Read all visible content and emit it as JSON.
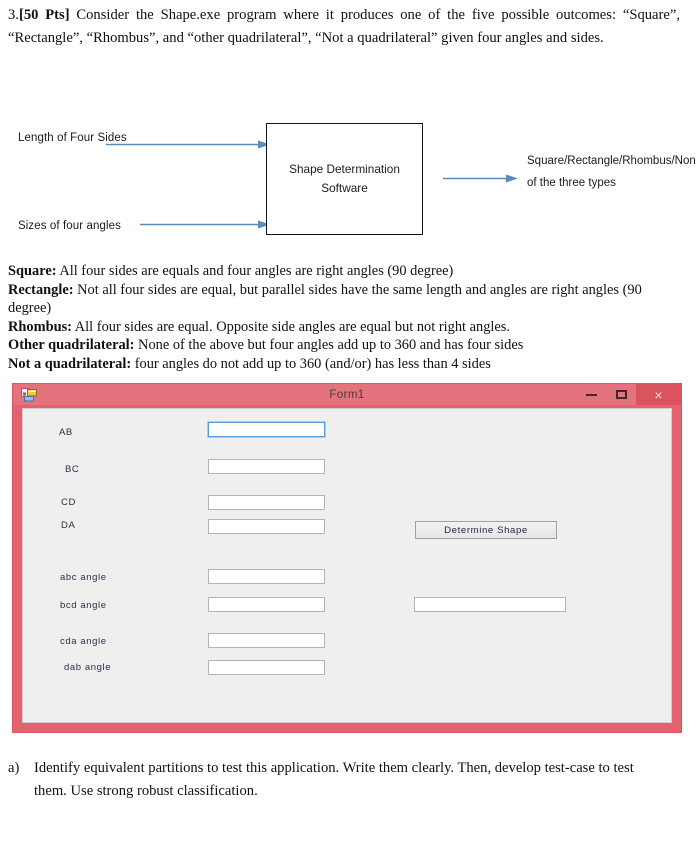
{
  "question_header": {
    "number": "3.",
    "points": "[50 Pts]",
    "text": " Consider the Shape.exe program where it produces one of the five possible outcomes: “Square”, “Rectangle”, “Rhombus”, and “other quadrilateral”, “Not a quadrilateral” given four angles and sides."
  },
  "diagram": {
    "input_top": "Length of Four Sides",
    "input_bottom": "Sizes of four angles",
    "box_line1": "Shape Determination",
    "box_line2": "Software",
    "output": "Square/Rectangle/Rhombus/None of the three types",
    "arrow_color": "#5b8db8"
  },
  "definitions": [
    {
      "term": "Square:",
      "desc": " All four sides are equals and four angles are right angles (90 degree)"
    },
    {
      "term": "Rectangle:",
      "desc": " Not all four sides are equal, but parallel sides have the same length and angles are right angles (90 degree)"
    },
    {
      "term": "Rhombus:",
      "desc": " All four sides are equal. Opposite side angles are equal but not right angles."
    },
    {
      "term": "Other quadrilateral:",
      "desc": " None of the above but four angles add up to 360 and has four sides"
    },
    {
      "term": "Not a quadrilateral:",
      "desc": " four angles do not add up to 360 (and/or) has less than 4 sides"
    }
  ],
  "form": {
    "title": "Form1",
    "titlebar_color": "#e4737e",
    "border_color": "#e4626f",
    "close_button_color": "#d9545f",
    "client_color": "#efefef",
    "icon_name": "vb-form-icon",
    "window_buttons": {
      "minimize": "minimize",
      "maximize": "maximize",
      "close": "×"
    },
    "side_labels": [
      "AB",
      "BC",
      "CD",
      "DA"
    ],
    "angle_labels": [
      "abc angle",
      "bcd angle",
      "cda angle",
      "dab angle"
    ],
    "side_values": [
      "",
      "",
      "",
      ""
    ],
    "angle_values": [
      "",
      "",
      "",
      ""
    ],
    "result_value": "",
    "determine_button": "Determine Shape"
  },
  "question_bottom": {
    "marker": "a)",
    "text": "Identify equivalent partitions to test this application. Write them clearly. Then, develop test-case to test them. Use strong robust classification."
  }
}
